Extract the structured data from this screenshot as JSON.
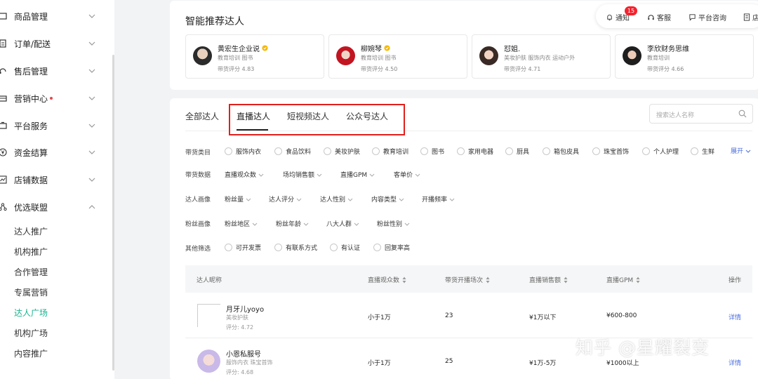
{
  "sidebar": {
    "items": [
      {
        "label": "商品管理",
        "icon": "product-icon",
        "chevron": "down"
      },
      {
        "label": "订单/配送",
        "icon": "order-icon",
        "chevron": "down"
      },
      {
        "label": "售后管理",
        "icon": "headset-icon",
        "chevron": "down"
      },
      {
        "label": "营销中心",
        "icon": "marketing-icon",
        "chevron": "down",
        "dot": true
      },
      {
        "label": "平台服务",
        "icon": "service-icon",
        "chevron": "down"
      },
      {
        "label": "资金结算",
        "icon": "yen-icon",
        "chevron": "down"
      },
      {
        "label": "店铺数据",
        "icon": "chart-icon",
        "chevron": "down"
      },
      {
        "label": "优选联盟",
        "icon": "alliance-icon",
        "chevron": "up"
      }
    ],
    "sub_items": [
      {
        "label": "达人推广",
        "active": false
      },
      {
        "label": "机构推广",
        "active": false
      },
      {
        "label": "合作管理",
        "active": false
      },
      {
        "label": "专属营销",
        "active": false
      },
      {
        "label": "达人广场",
        "active": true
      },
      {
        "label": "机构广场",
        "active": false
      },
      {
        "label": "内容推广",
        "active": false
      }
    ],
    "accent_color": "#17b38f"
  },
  "top": {
    "title": "智能推荐达人",
    "toolbar": {
      "notify_label": "通知",
      "notify_count": "15",
      "service_label": "客服",
      "consult_label": "平台咨询",
      "extra_label": "店"
    },
    "recommended": [
      {
        "name": "黄宏生企业说",
        "verified": true,
        "tags": "教育培训 图书",
        "score": "带货评分 4.83"
      },
      {
        "name": "柳婉琴",
        "verified": true,
        "tags": "教育培训 图书",
        "score": "带货评分 4.50"
      },
      {
        "name": "怼姐.",
        "verified": false,
        "tags": "美妆护肤 服饰内衣 运动户外",
        "score": "带货评分 4.71"
      },
      {
        "name": "李欣财务思维",
        "verified": false,
        "tags": "教育培训",
        "score": "带货评分 4.66"
      }
    ]
  },
  "main": {
    "tabs": [
      {
        "label": "全部达人",
        "active": false
      },
      {
        "label": "直播达人",
        "active": true
      },
      {
        "label": "短视频达人",
        "active": false
      },
      {
        "label": "公众号达人",
        "active": false
      }
    ],
    "search_placeholder": "搜索达人名称",
    "filters": {
      "category_label": "带货类目",
      "categories": [
        "服饰内衣",
        "食品饮料",
        "美妆护肤",
        "教育培训",
        "图书",
        "家用电器",
        "厨具",
        "箱包皮具",
        "珠宝首饰",
        "个人护理",
        "生鲜"
      ],
      "expand_label": "展开",
      "data_label": "带货数据",
      "data_options": [
        "直播观众数",
        "场均销售额",
        "直播GPM",
        "客单价"
      ],
      "persona_label": "达人画像",
      "persona_options": [
        "粉丝量",
        "达人评分",
        "达人性别",
        "内容类型",
        "开播频率"
      ],
      "fans_label": "粉丝画像",
      "fans_options": [
        "粉丝地区",
        "粉丝年龄",
        "八大人群",
        "粉丝性别"
      ],
      "other_label": "其他筛选",
      "other_options": [
        "可开发票",
        "有联系方式",
        "有认证",
        "回复率高"
      ]
    },
    "table": {
      "headers": [
        "达人昵称",
        "直播观众数",
        "带货开播场次",
        "直播销售额",
        "直播GPM",
        "操作"
      ],
      "rows": [
        {
          "name": "月牙儿yoyo",
          "tags": "美妆护肤",
          "score": "评分: 4.72",
          "viewers": "小于1万",
          "sessions": "23",
          "sales": "¥1万以下",
          "gpm": "¥600-800",
          "action": "详情"
        },
        {
          "name": "小恩私服号",
          "tags": "服饰内衣 珠宝首饰",
          "score": "评分: 4.68",
          "viewers": "小于1万",
          "sessions": "25",
          "sales": "¥1万-5万",
          "gpm": "¥1000以上",
          "action": "详情"
        }
      ]
    }
  },
  "watermark": "知乎 @星耀裂变",
  "highlight_color": "#e0201c"
}
